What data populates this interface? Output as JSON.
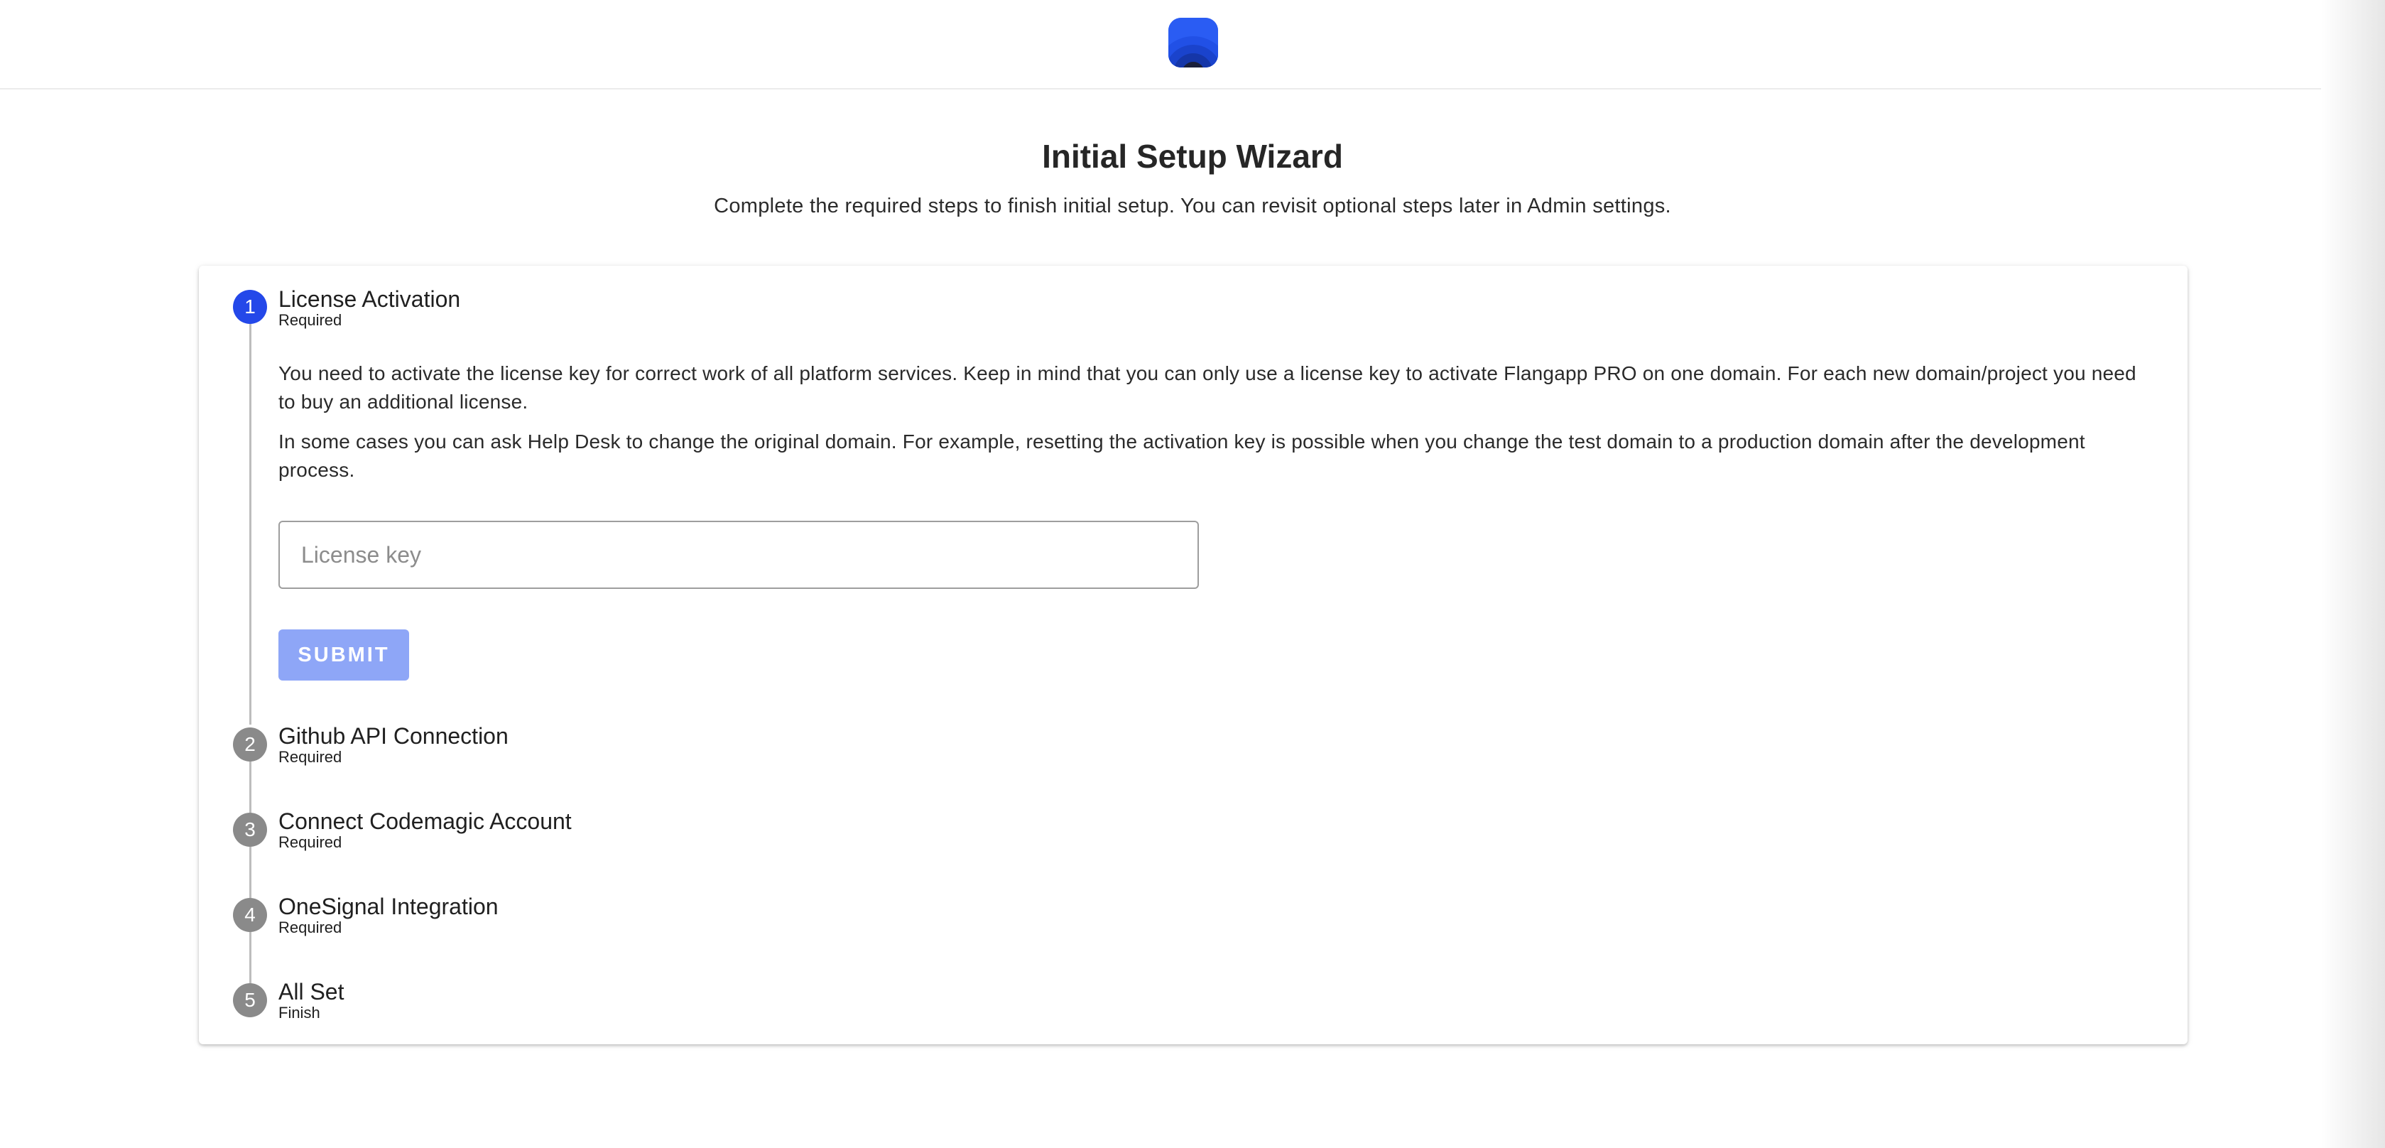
{
  "header": {
    "logo_icon": "flangapp-logo-icon",
    "brand_color": "#2a5cf3"
  },
  "page": {
    "title": "Initial Setup Wizard",
    "subtitle": "Complete the required steps to finish initial setup. You can revisit optional steps later in Admin settings."
  },
  "wizard": {
    "active_color": "#2448e9",
    "inactive_color": "#8a8a8a",
    "steps": [
      {
        "number": "1",
        "title": "License Activation",
        "caption": "Required",
        "active": true,
        "description": [
          "You need to activate the license key for correct work of all platform services. Keep in mind that you can only use a license key to activate Flangapp PRO on one domain. For each new domain/project you need to buy an additional license.",
          "In some cases you can ask Help Desk to change the original domain. For example, resetting the activation key is possible when you change the test domain to a production domain after the development process."
        ],
        "input": {
          "placeholder": "License key",
          "value": ""
        },
        "submit_label": "SUBMIT"
      },
      {
        "number": "2",
        "title": "Github API Connection",
        "caption": "Required",
        "active": false
      },
      {
        "number": "3",
        "title": "Connect Codemagic Account",
        "caption": "Required",
        "active": false
      },
      {
        "number": "4",
        "title": "OneSignal Integration",
        "caption": "Required",
        "active": false
      },
      {
        "number": "5",
        "title": "All Set",
        "caption": "Finish",
        "active": false
      }
    ]
  }
}
